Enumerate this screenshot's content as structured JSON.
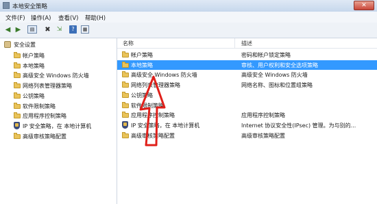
{
  "window": {
    "title": "本地安全策略",
    "close_glyph": "✕"
  },
  "menu": [
    "文件(F)",
    "操作(A)",
    "查看(V)",
    "帮助(H)"
  ],
  "toolbar": [
    "back-icon",
    "forward-icon",
    "show-hide-tree-icon",
    "delete-icon",
    "export-icon",
    "help-icon",
    "console-icon"
  ],
  "tree": {
    "root": "安全设置",
    "items": [
      {
        "label": "帐户策略",
        "icon": "folder-icon"
      },
      {
        "label": "本地策略",
        "icon": "folder-icon"
      },
      {
        "label": "高级安全 Windows 防火墙",
        "icon": "folder-icon"
      },
      {
        "label": "网络列表管理器策略",
        "icon": "folder-icon"
      },
      {
        "label": "公钥策略",
        "icon": "folder-icon"
      },
      {
        "label": "软件限制策略",
        "icon": "folder-icon"
      },
      {
        "label": "应用程序控制策略",
        "icon": "folder-icon"
      },
      {
        "label": "IP 安全策略，在 本地计算机",
        "icon": "shield-icon"
      },
      {
        "label": "高级审核策略配置",
        "icon": "folder-icon"
      }
    ]
  },
  "list": {
    "columns": [
      "名称",
      "描述"
    ],
    "rows": [
      {
        "name": "帐户策略",
        "desc": "密码和帐户锁定策略",
        "icon": "folder-icon",
        "selected": false
      },
      {
        "name": "本地策略",
        "desc": "审核、用户权利和安全选项策略",
        "icon": "folder-icon",
        "selected": true
      },
      {
        "name": "高级安全 Windows 防火墙",
        "desc": "高级安全 Windows 防火墙",
        "icon": "folder-icon",
        "selected": false
      },
      {
        "name": "网络列表管理器策略",
        "desc": "网络名称、图标和位置组策略",
        "icon": "folder-icon",
        "selected": false
      },
      {
        "name": "公钥策略",
        "desc": "",
        "icon": "folder-icon",
        "selected": false
      },
      {
        "name": "软件限制策略",
        "desc": "",
        "icon": "folder-icon",
        "selected": false
      },
      {
        "name": "应用程序控制策略",
        "desc": "应用程序控制策略",
        "icon": "folder-icon",
        "selected": false
      },
      {
        "name": "IP 安全策略，在 本地计算机",
        "desc": "Internet 协议安全性(IPsec) 管理。为与别的...",
        "icon": "shield-icon",
        "selected": false
      },
      {
        "name": "高级审核策略配置",
        "desc": "高级审核策略配置",
        "icon": "folder-icon",
        "selected": false
      }
    ]
  },
  "annotation": {
    "color": "#e0201a"
  }
}
